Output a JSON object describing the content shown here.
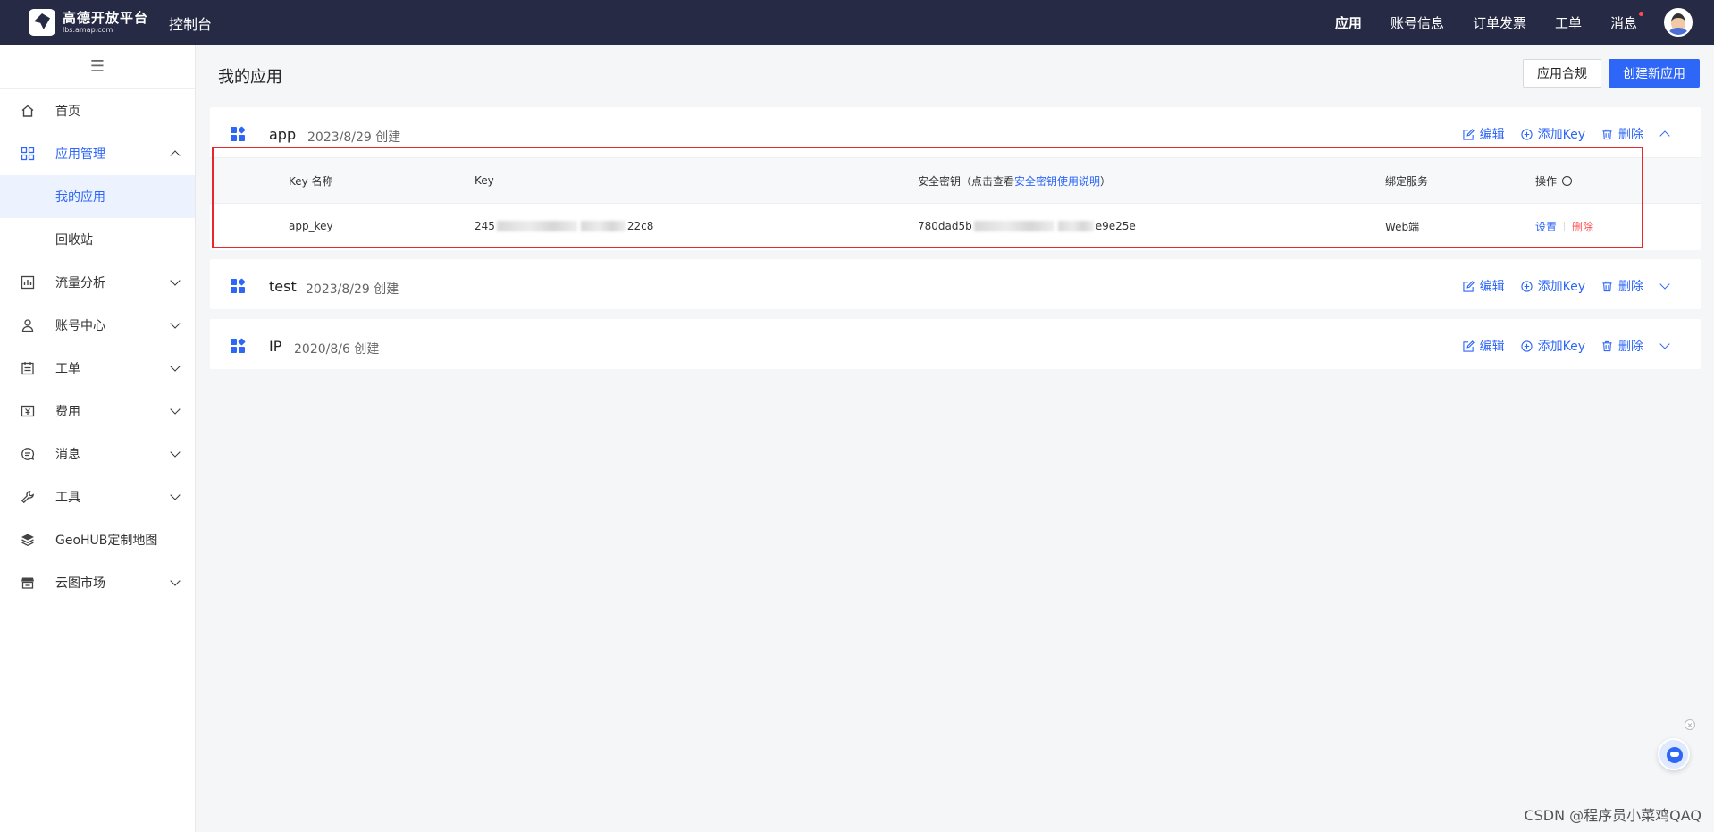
{
  "header": {
    "logo_text": "高德开放平台",
    "logo_sub": "lbs.amap.com",
    "console_label": "控制台",
    "nav": [
      {
        "label": "应用",
        "active": true
      },
      {
        "label": "账号信息"
      },
      {
        "label": "订单发票"
      },
      {
        "label": "工单"
      },
      {
        "label": "消息",
        "has_dot": true
      }
    ]
  },
  "sidebar": {
    "items": [
      {
        "label": "首页",
        "icon": "home-icon"
      },
      {
        "label": "应用管理",
        "icon": "grid-icon",
        "expanded": true
      },
      {
        "label": "我的应用",
        "selected": true
      },
      {
        "label": "回收站"
      },
      {
        "label": "流量分析",
        "icon": "chart-icon"
      },
      {
        "label": "账号中心",
        "icon": "user-icon"
      },
      {
        "label": "工单",
        "icon": "ticket-icon"
      },
      {
        "label": "费用",
        "icon": "fee-icon"
      },
      {
        "label": "消息",
        "icon": "message-icon"
      },
      {
        "label": "工具",
        "icon": "wrench-icon"
      },
      {
        "label": "GeoHUB定制地图",
        "icon": "layers-icon"
      },
      {
        "label": "云图市场",
        "icon": "store-icon"
      }
    ]
  },
  "main": {
    "page_title": "我的应用",
    "btn_compliance": "应用合规",
    "btn_create": "创建新应用",
    "action_edit": "编辑",
    "action_add_key": "添加Key",
    "action_delete": "删除",
    "apps": [
      {
        "name": "app",
        "created": "2023/8/29 创建",
        "expanded": true
      },
      {
        "name": "test",
        "created": "2023/8/29 创建"
      },
      {
        "name": "IP",
        "created": "2020/8/6 创建"
      }
    ],
    "key_table": {
      "col_name": "Key 名称",
      "col_key": "Key",
      "col_secret_prefix": "安全密钥（点击查看",
      "col_secret_link": "安全密钥使用说明",
      "col_secret_suffix": "）",
      "col_service": "绑定服务",
      "col_ops": "操作",
      "row": {
        "name": "app_key",
        "key_start": "245",
        "key_end": "22c8",
        "secret_start": "780dad5b",
        "secret_end": "e9e25e",
        "service": "Web端",
        "op_settings": "设置",
        "op_delete": "删除"
      }
    }
  },
  "watermark": "CSDN @程序员小菜鸡QAQ",
  "colors": {
    "accent": "#2e67f8",
    "topbar": "#262a45",
    "danger": "#ff4d4f",
    "highlight_box": "#e8292b"
  }
}
